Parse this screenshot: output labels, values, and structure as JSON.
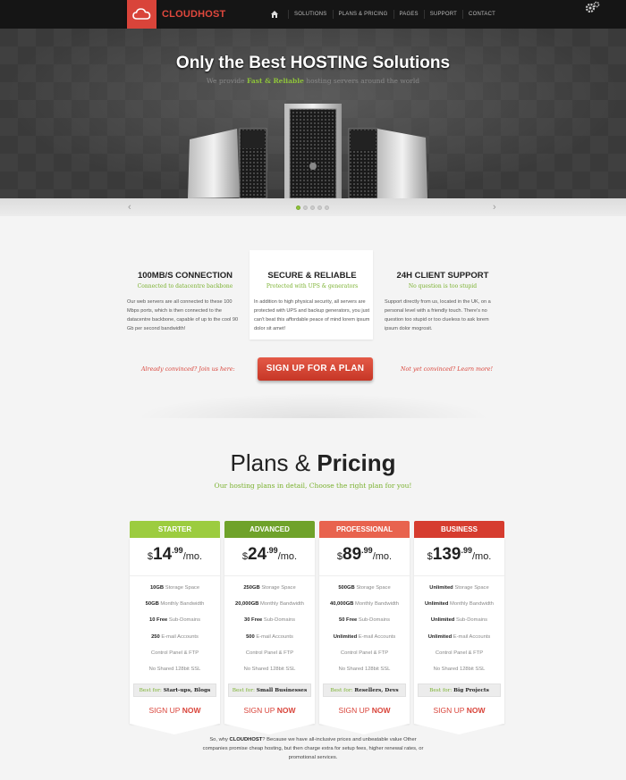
{
  "brand": {
    "name": "CLOUDHOST",
    "accent": "#d9443a",
    "green": "#8fc43a"
  },
  "nav": {
    "home_icon": "home-icon",
    "items": [
      "SOLUTIONS",
      "PLANS & PRICING",
      "PAGES",
      "SUPPORT",
      "CONTACT"
    ],
    "settings_icon": "gears-icon"
  },
  "hero": {
    "title": "Only the Best HOSTING Solutions",
    "sub_before": "We provide ",
    "sub_highlight": "Fast & Reliable",
    "sub_after": " hosting servers around the world",
    "slides": 5,
    "active_slide": 1
  },
  "features": [
    {
      "title": "100MB/S CONNECTION",
      "subtitle": "Connected to datacentre backbone",
      "text": "Our web servers are all connected to these 100 Mbps ports, which is then connected to the datacentre backbone, capable of up to the cool 90 Gb per second bandwidth!"
    },
    {
      "title": "SECURE & RELIABLE",
      "subtitle": "Protected with UPS & generators",
      "text": "In addition to high physical security, all servers are protected with UPS and backup generators, you just can't beat this affordable peace of mind lorem ipsum dolor sit amet!"
    },
    {
      "title": "24H CLIENT SUPPORT",
      "subtitle": "No question is too stupid",
      "text": "Support directly from us, located in the UK, on a personal level with a friendly touch. There's no question too stupid or too clueless to ask lorem ipsum dolor mogrosit."
    }
  ],
  "cta": {
    "left": "Already convinced? Join us here:",
    "button": "SIGN UP FOR A PLAN",
    "right": "Not yet convinced? Learn more!"
  },
  "pricing": {
    "title_light": "Plans & ",
    "title_bold": "Pricing",
    "subtitle": "Our hosting plans in detail, Choose the right plan for you!",
    "plans": [
      {
        "name": "STARTER",
        "color": "#9ccc3f",
        "currency": "$",
        "price": "14",
        "cents": ".99",
        "per": "/mo.",
        "features": [
          [
            "10GB",
            " Storage Space"
          ],
          [
            "50GB",
            " Monthly Bandwidth"
          ],
          [
            "10 Free",
            " Sub-Domains"
          ],
          [
            "250",
            " E-mail Accounts"
          ],
          [
            "",
            "Control Panel & FTP"
          ],
          [
            "",
            "No Shared 128bit SSL"
          ]
        ],
        "best_label": "Best for: ",
        "best_value": "Start-ups, Blogs",
        "signup": "SIGN UP ",
        "signup_bold": "NOW"
      },
      {
        "name": "ADVANCED",
        "color": "#6fa22a",
        "currency": "$",
        "price": "24",
        "cents": ".99",
        "per": "/mo.",
        "features": [
          [
            "250GB",
            " Storage Space"
          ],
          [
            "20,000GB",
            " Monthly Bandwidth"
          ],
          [
            "30 Free",
            " Sub-Domains"
          ],
          [
            "500",
            " E-mail Accounts"
          ],
          [
            "",
            "Control Panel & FTP"
          ],
          [
            "",
            "No Shared 128bit SSL"
          ]
        ],
        "best_label": "Best for: ",
        "best_value": "Small Businesses",
        "signup": "SIGN UP ",
        "signup_bold": "NOW"
      },
      {
        "name": "PROFESSIONAL",
        "color": "#e8634e",
        "currency": "$",
        "price": "89",
        "cents": ".99",
        "per": "/mo.",
        "features": [
          [
            "500GB",
            " Storage Space"
          ],
          [
            "40,000GB",
            " Monthly Bandwidth"
          ],
          [
            "50 Free",
            " Sub-Domains"
          ],
          [
            "Unlimited",
            " E-mail Accounts"
          ],
          [
            "",
            "Control Panel & FTP"
          ],
          [
            "",
            "No Shared 128bit SSL"
          ]
        ],
        "best_label": "Best for: ",
        "best_value": "Resellers, Devs",
        "signup": "SIGN UP ",
        "signup_bold": "NOW"
      },
      {
        "name": "BUSINESS",
        "color": "#d63c2f",
        "currency": "$",
        "price": "139",
        "cents": ".99",
        "per": "/mo.",
        "features": [
          [
            "Unlimited",
            " Storage Space"
          ],
          [
            "Unlimited",
            " Monthly Bandwidth"
          ],
          [
            "Unlimited",
            " Sub-Domains"
          ],
          [
            "Unlimited",
            " E-mail Accounts"
          ],
          [
            "",
            "Control Panel & FTP"
          ],
          [
            "",
            "No Shared 128bit SSL"
          ]
        ],
        "best_label": "Best for: ",
        "best_value": "Big Projects",
        "signup": "SIGN UP ",
        "signup_bold": "NOW"
      }
    ]
  },
  "why": {
    "before": "So, why ",
    "brand": "CLOUDHOST",
    "after": "? Because we have all-inclusive prices and unbeatable value Other companies promise cheap hosting, but then charge extra for setup fees, higher renewal rates, or promotional services."
  }
}
